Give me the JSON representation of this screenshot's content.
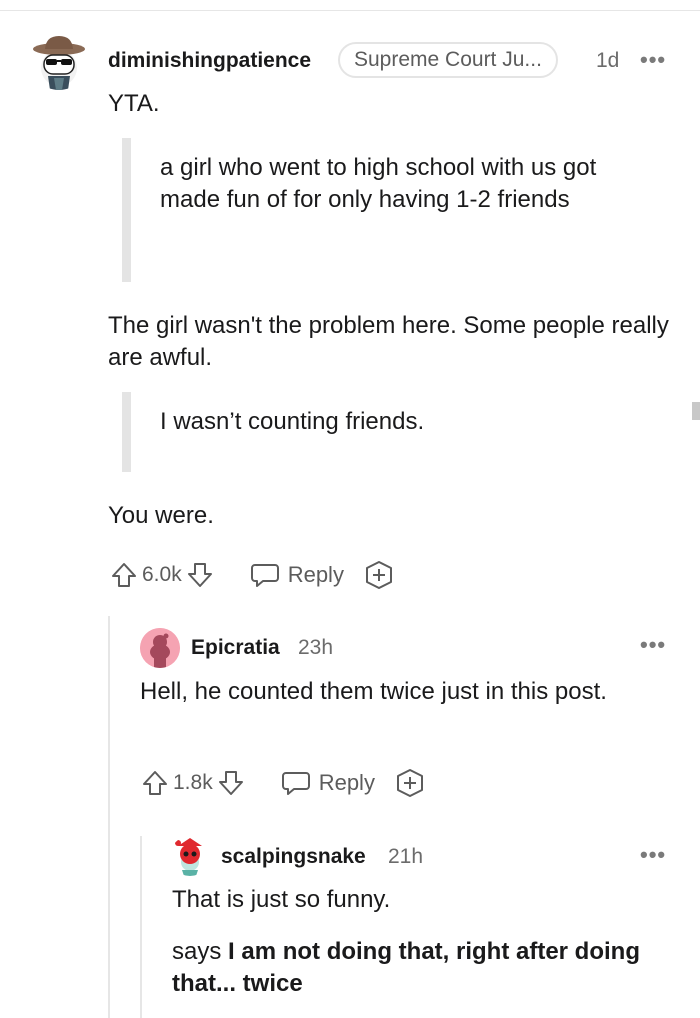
{
  "comments": [
    {
      "username": "diminishingpatience",
      "flair": "Supreme Court Ju...",
      "time": "1d",
      "more": "•••",
      "paragraph1": "YTA.",
      "quote1": "a girl who went to high school with us got made fun of for only having 1-2 friends",
      "paragraph2": "The girl wasn't the problem here. Some people really are awful.",
      "quote2": "I wasn’t counting friends.",
      "paragraph3": "You were.",
      "votes": "6.0k",
      "reply_label": "Reply"
    },
    {
      "username": "Epicratia",
      "time": "23h",
      "more": "•••",
      "paragraph1": "Hell, he counted them twice just in this post.",
      "votes": "1.8k",
      "reply_label": "Reply"
    },
    {
      "username": "scalpingsnake",
      "time": "21h",
      "more": "•••",
      "paragraph1": "That is just so funny.",
      "paragraph2_prefix": "says ",
      "paragraph2_bold": "I am not doing that, right after doing that... twice"
    }
  ],
  "icons": {
    "upvote": "upvote-arrow-icon",
    "downvote": "downvote-arrow-icon",
    "reply": "speech-bubble-icon",
    "award": "add-award-icon",
    "more": "more-options-icon"
  },
  "colors": {
    "text": "#1a1a1b",
    "meta": "#6b6b6b",
    "quote_bar": "#e4e4e4",
    "avatar2_bg": "#f5a3b2",
    "avatar3_accent": "#e0292f"
  }
}
